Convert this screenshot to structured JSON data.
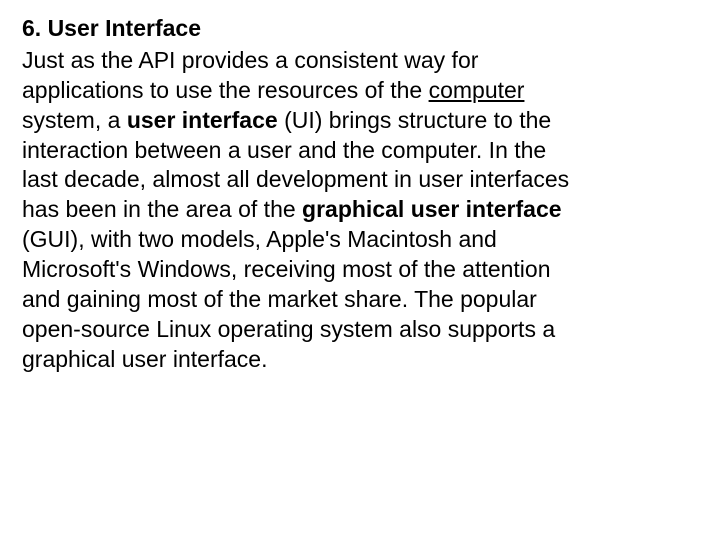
{
  "heading": "6. User Interface",
  "para": {
    "seg1": "Just as the API provides a consistent way for applications to use the resources of the",
    "link_computer_space": " ",
    "link_computer": "computer",
    "seg2_space": " ",
    "seg2": "system, a",
    "seg3_space": " ",
    "bold_ui": "user interface",
    "seg4_space": " ",
    "seg4": "(UI) brings structure to the interaction between a user and the computer. In the last decade, almost all development in user interfaces has been in the area of the",
    "seg5_space": " ",
    "bold_gui": "graphical user interface",
    "seg6_space": " ",
    "seg6": "(GUI), with two models, Apple's Macintosh and Microsoft's Windows, receiving most of the attention and gaining most of the market share. The popular open-source Linux operating system also supports a graphical user interface."
  }
}
